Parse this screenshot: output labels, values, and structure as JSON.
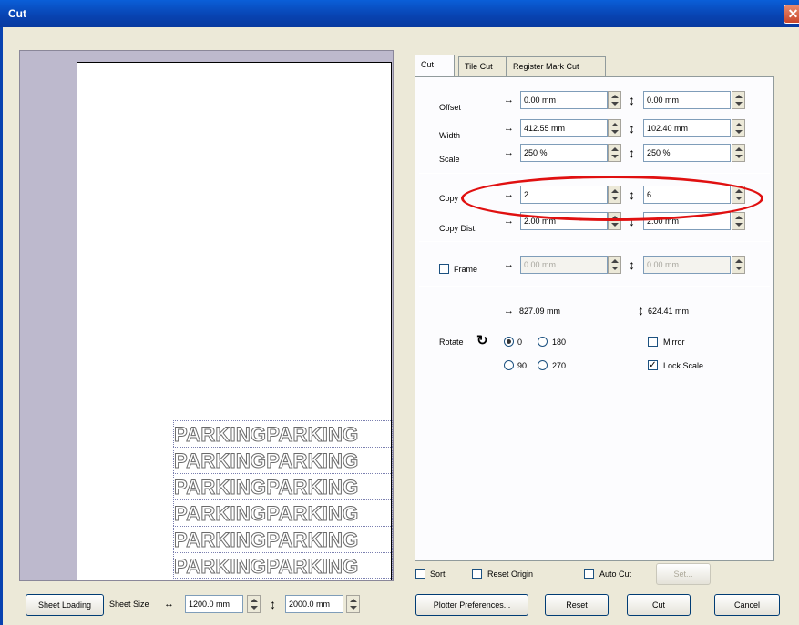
{
  "window": {
    "title": "Cut",
    "close_icon": "close-icon"
  },
  "preview": {
    "text_rows": [
      "PARKINGPARKING",
      "PARKINGPARKING",
      "PARKINGPARKING",
      "PARKINGPARKING",
      "PARKINGPARKING",
      "PARKINGPARKING"
    ]
  },
  "tabs": [
    "Cut",
    "Tile Cut",
    "Register Mark Cut"
  ],
  "fields": {
    "offset": {
      "label": "Offset",
      "h": "0.00 mm",
      "v": "0.00 mm"
    },
    "width": {
      "label": "Width",
      "h": "412.55 mm",
      "v": "102.40 mm"
    },
    "scale": {
      "label": "Scale",
      "h": "250 %",
      "v": "250 %"
    },
    "copy": {
      "label": "Copy",
      "h": "2",
      "v": "6"
    },
    "copy_dist": {
      "label": "Copy Dist.",
      "h": "2.00 mm",
      "v": "2.00 mm"
    },
    "frame": {
      "label": "Frame",
      "h": "0.00 mm",
      "v": "0.00 mm"
    }
  },
  "size": {
    "h": "827.09 mm",
    "v": "624.41 mm"
  },
  "rotate": {
    "label": "Rotate",
    "options": [
      "0",
      "180",
      "90",
      "270"
    ],
    "selected": "0",
    "mirror_label": "Mirror",
    "lock_scale_label": "Lock Scale"
  },
  "bottom_options": {
    "sort": "Sort",
    "reset_origin": "Reset Origin",
    "auto_cut": "Auto Cut",
    "set": "Set..."
  },
  "sheet": {
    "loading_label": "Sheet Loading",
    "size_label": "Sheet Size",
    "width": "1200.0 mm",
    "height": "2000.0 mm"
  },
  "buttons": {
    "plotter_prefs": "Plotter Preferences...",
    "reset": "Reset",
    "cut": "Cut",
    "cancel": "Cancel"
  },
  "colors": {
    "titlebar": "#0842b0",
    "highlight": "#e01010"
  }
}
